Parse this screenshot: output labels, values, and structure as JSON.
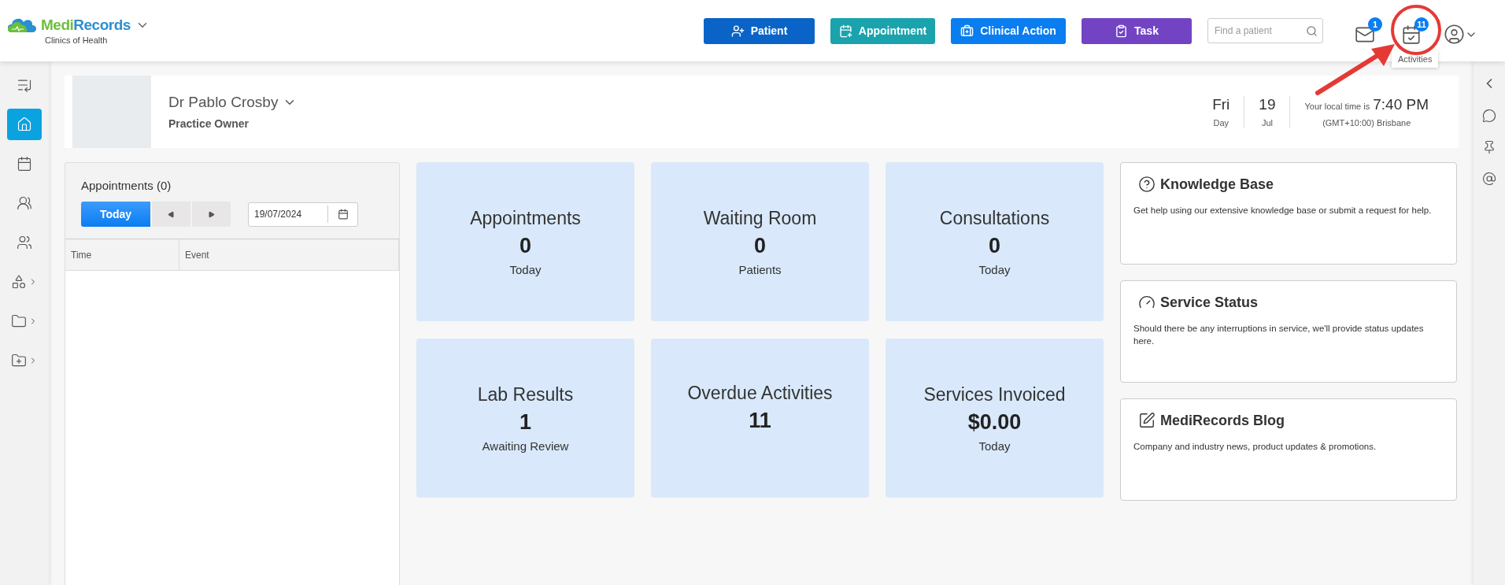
{
  "logo": {
    "first": "Medi",
    "second": "Records",
    "subtitle": "Clinics of Health"
  },
  "actions": [
    {
      "label": "Patient",
      "color": "#0a64c8"
    },
    {
      "label": "Appointment",
      "color": "#1ba3ad"
    },
    {
      "label": "Clinical Action",
      "color": "#0a7df0"
    },
    {
      "label": "Task",
      "color": "#7244c4"
    }
  ],
  "search": {
    "placeholder": "Find a patient"
  },
  "notifications": {
    "mail_count": "1",
    "activities_count": "11",
    "tooltip": "Activities"
  },
  "sidebar": {
    "items": [
      {
        "selected": false,
        "has_submenu": false
      },
      {
        "selected": true,
        "has_submenu": false
      },
      {
        "selected": false,
        "has_submenu": false
      },
      {
        "selected": false,
        "has_submenu": false
      },
      {
        "selected": false,
        "has_submenu": false
      },
      {
        "selected": false,
        "has_submenu": true
      },
      {
        "selected": false,
        "has_submenu": true
      },
      {
        "selected": false,
        "has_submenu": true
      }
    ]
  },
  "profile": {
    "name": "Dr Pablo Crosby",
    "role": "Practice Owner",
    "day": "Fri",
    "day_label": "Day",
    "date": "19",
    "month": "Jul",
    "time_label": "Your local time is",
    "time": "7:40 PM",
    "timezone": "(GMT+10:00) Brisbane"
  },
  "appointments": {
    "title": "Appointments (0)",
    "today_button": "Today",
    "date": "19/07/2024",
    "columns": [
      "Time",
      "Event"
    ]
  },
  "tiles": [
    {
      "title": "Appointments",
      "value": "0",
      "caption": "Today"
    },
    {
      "title": "Waiting Room",
      "value": "0",
      "caption": "Patients"
    },
    {
      "title": "Consultations",
      "value": "0",
      "caption": "Today"
    },
    {
      "title": "Lab Results",
      "value": "1",
      "caption": "Awaiting Review"
    },
    {
      "title": "Overdue Activities",
      "value": "11"
    },
    {
      "title": "Services Invoiced",
      "value": "$0.00",
      "caption": "Today"
    }
  ],
  "info_cards": [
    {
      "title": "Knowledge Base",
      "text": "Get help using our extensive knowledge base or submit a request for help."
    },
    {
      "title": "Service Status",
      "text": "Should there be any interruptions in service, we'll provide status updates here."
    },
    {
      "title": "MediRecords Blog",
      "text": "Company and industry news, product updates & promotions."
    }
  ]
}
